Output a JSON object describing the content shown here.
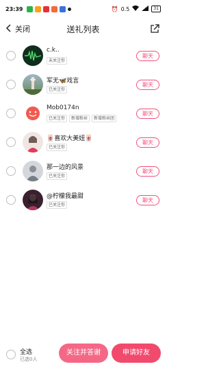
{
  "status_bar": {
    "time": "23:39",
    "network_speed": "0.5",
    "battery": "31"
  },
  "nav": {
    "back_label": "关闭",
    "title": "送礼列表"
  },
  "list": [
    {
      "name": "c.k..",
      "tags": [
        "未关注你"
      ],
      "chat": "聊天",
      "avatar_color": "#0f2e1c"
    },
    {
      "name": "军无🦋戏言",
      "tags": [
        "已关注你"
      ],
      "chat": "聊天",
      "avatar_color": "#6b8a5a"
    },
    {
      "name": "Mob0174n",
      "tags": [
        "已关注你",
        "新增粉丝",
        "新增粉丝团"
      ],
      "chat": "聊天",
      "avatar_color": "#f15b4f"
    },
    {
      "name": "🀄喜欢大美妞🀄",
      "tags": [
        "已关注你"
      ],
      "chat": "聊天",
      "avatar_color": "#d9c6c2"
    },
    {
      "name": "那一边的风景",
      "tags": [
        "已关注你"
      ],
      "chat": "聊天",
      "avatar_color": "#c9cdd3"
    },
    {
      "name": "@柠檬我最甜",
      "tags": [
        "已关注你"
      ],
      "chat": "聊天",
      "avatar_color": "#4a2a3a"
    }
  ],
  "bottom": {
    "select_all": "全选",
    "selected_count": "已选0人",
    "follow_and_thank": "关注并答谢",
    "request_friend": "申请好友"
  }
}
